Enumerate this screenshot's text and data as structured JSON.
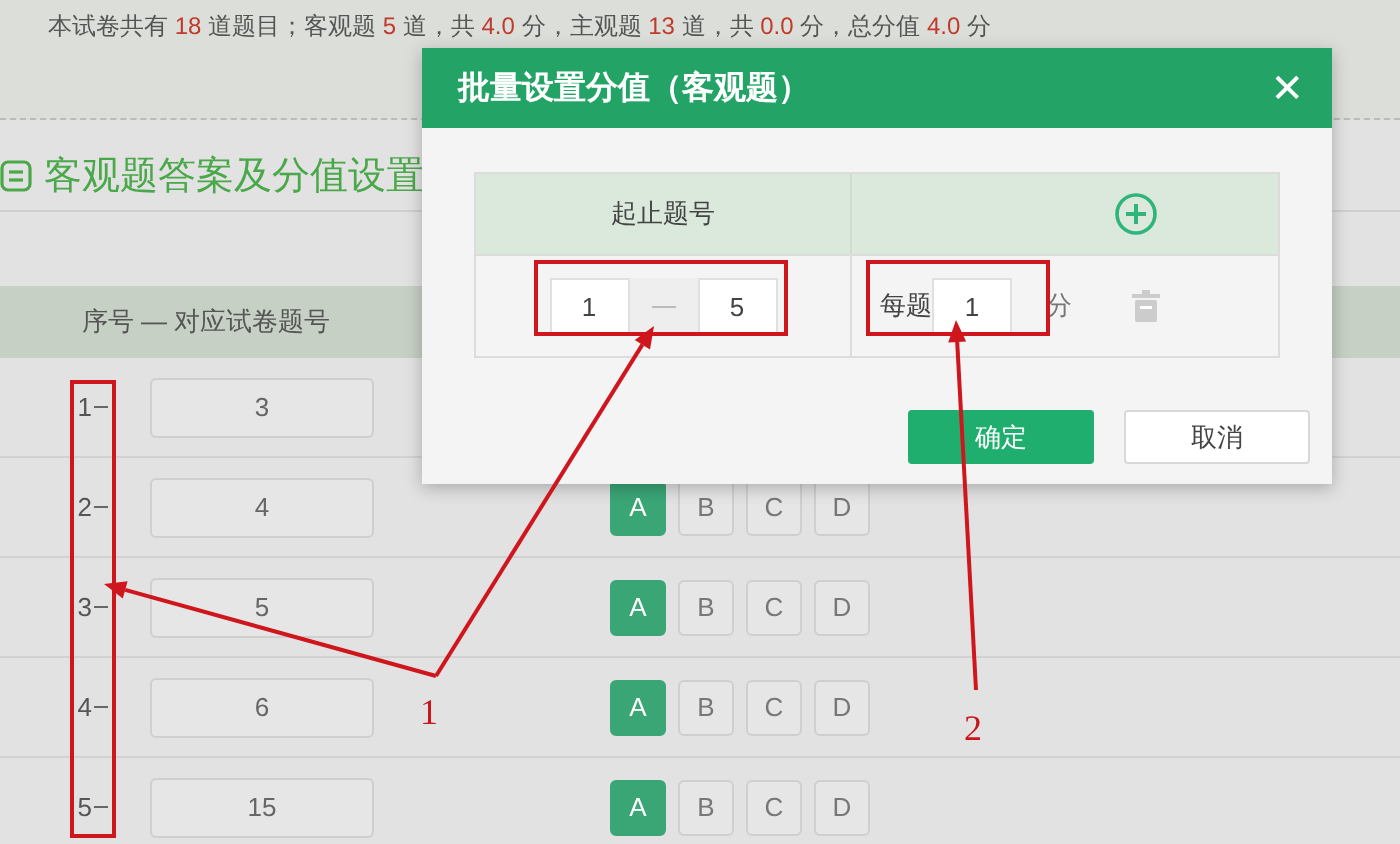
{
  "summary": [
    {
      "kind": "text",
      "text": "本试卷共有 "
    },
    {
      "kind": "number",
      "text": "18"
    },
    {
      "kind": "text",
      "text": " 道题目；客观题 "
    },
    {
      "kind": "number",
      "text": "5"
    },
    {
      "kind": "text",
      "text": " 道，共 "
    },
    {
      "kind": "number",
      "text": "4.0"
    },
    {
      "kind": "text",
      "text": " 分，主观题 "
    },
    {
      "kind": "number",
      "text": "13"
    },
    {
      "kind": "text",
      "text": " 道，共 "
    },
    {
      "kind": "number",
      "text": "0.0"
    },
    {
      "kind": "text",
      "text": " 分，总分值 "
    },
    {
      "kind": "number",
      "text": "4.0"
    },
    {
      "kind": "text",
      "text": " 分"
    }
  ],
  "section_title": "客观题答案及分值设置",
  "table": {
    "header": "序号 — 对应试卷题号",
    "rows": [
      {
        "seq": "1",
        "question": "3"
      },
      {
        "seq": "2",
        "question": "4",
        "options": [
          {
            "label": "A",
            "selected": true
          },
          {
            "label": "B",
            "selected": false
          },
          {
            "label": "C",
            "selected": false
          },
          {
            "label": "D",
            "selected": false
          }
        ]
      },
      {
        "seq": "3",
        "question": "5",
        "options": [
          {
            "label": "A",
            "selected": true
          },
          {
            "label": "B",
            "selected": false
          },
          {
            "label": "C",
            "selected": false
          },
          {
            "label": "D",
            "selected": false
          }
        ]
      },
      {
        "seq": "4",
        "question": "6",
        "options": [
          {
            "label": "A",
            "selected": true
          },
          {
            "label": "B",
            "selected": false
          },
          {
            "label": "C",
            "selected": false
          },
          {
            "label": "D",
            "selected": false
          }
        ]
      },
      {
        "seq": "5",
        "question": "15",
        "options": [
          {
            "label": "A",
            "selected": true
          },
          {
            "label": "B",
            "selected": false
          },
          {
            "label": "C",
            "selected": false
          },
          {
            "label": "D",
            "selected": false
          }
        ]
      }
    ]
  },
  "dialog": {
    "title": "批量设置分值（客观题）",
    "close": "✕",
    "range_header": "起止题号",
    "range_from": "1",
    "range_to": "5",
    "per_label": "每题",
    "per_value": "1",
    "per_unit": "分",
    "buttons": [
      {
        "label": "确定",
        "kind": "primary"
      },
      {
        "label": "取消",
        "kind": "secondary"
      }
    ]
  },
  "annotations": [
    "1",
    "2"
  ]
}
